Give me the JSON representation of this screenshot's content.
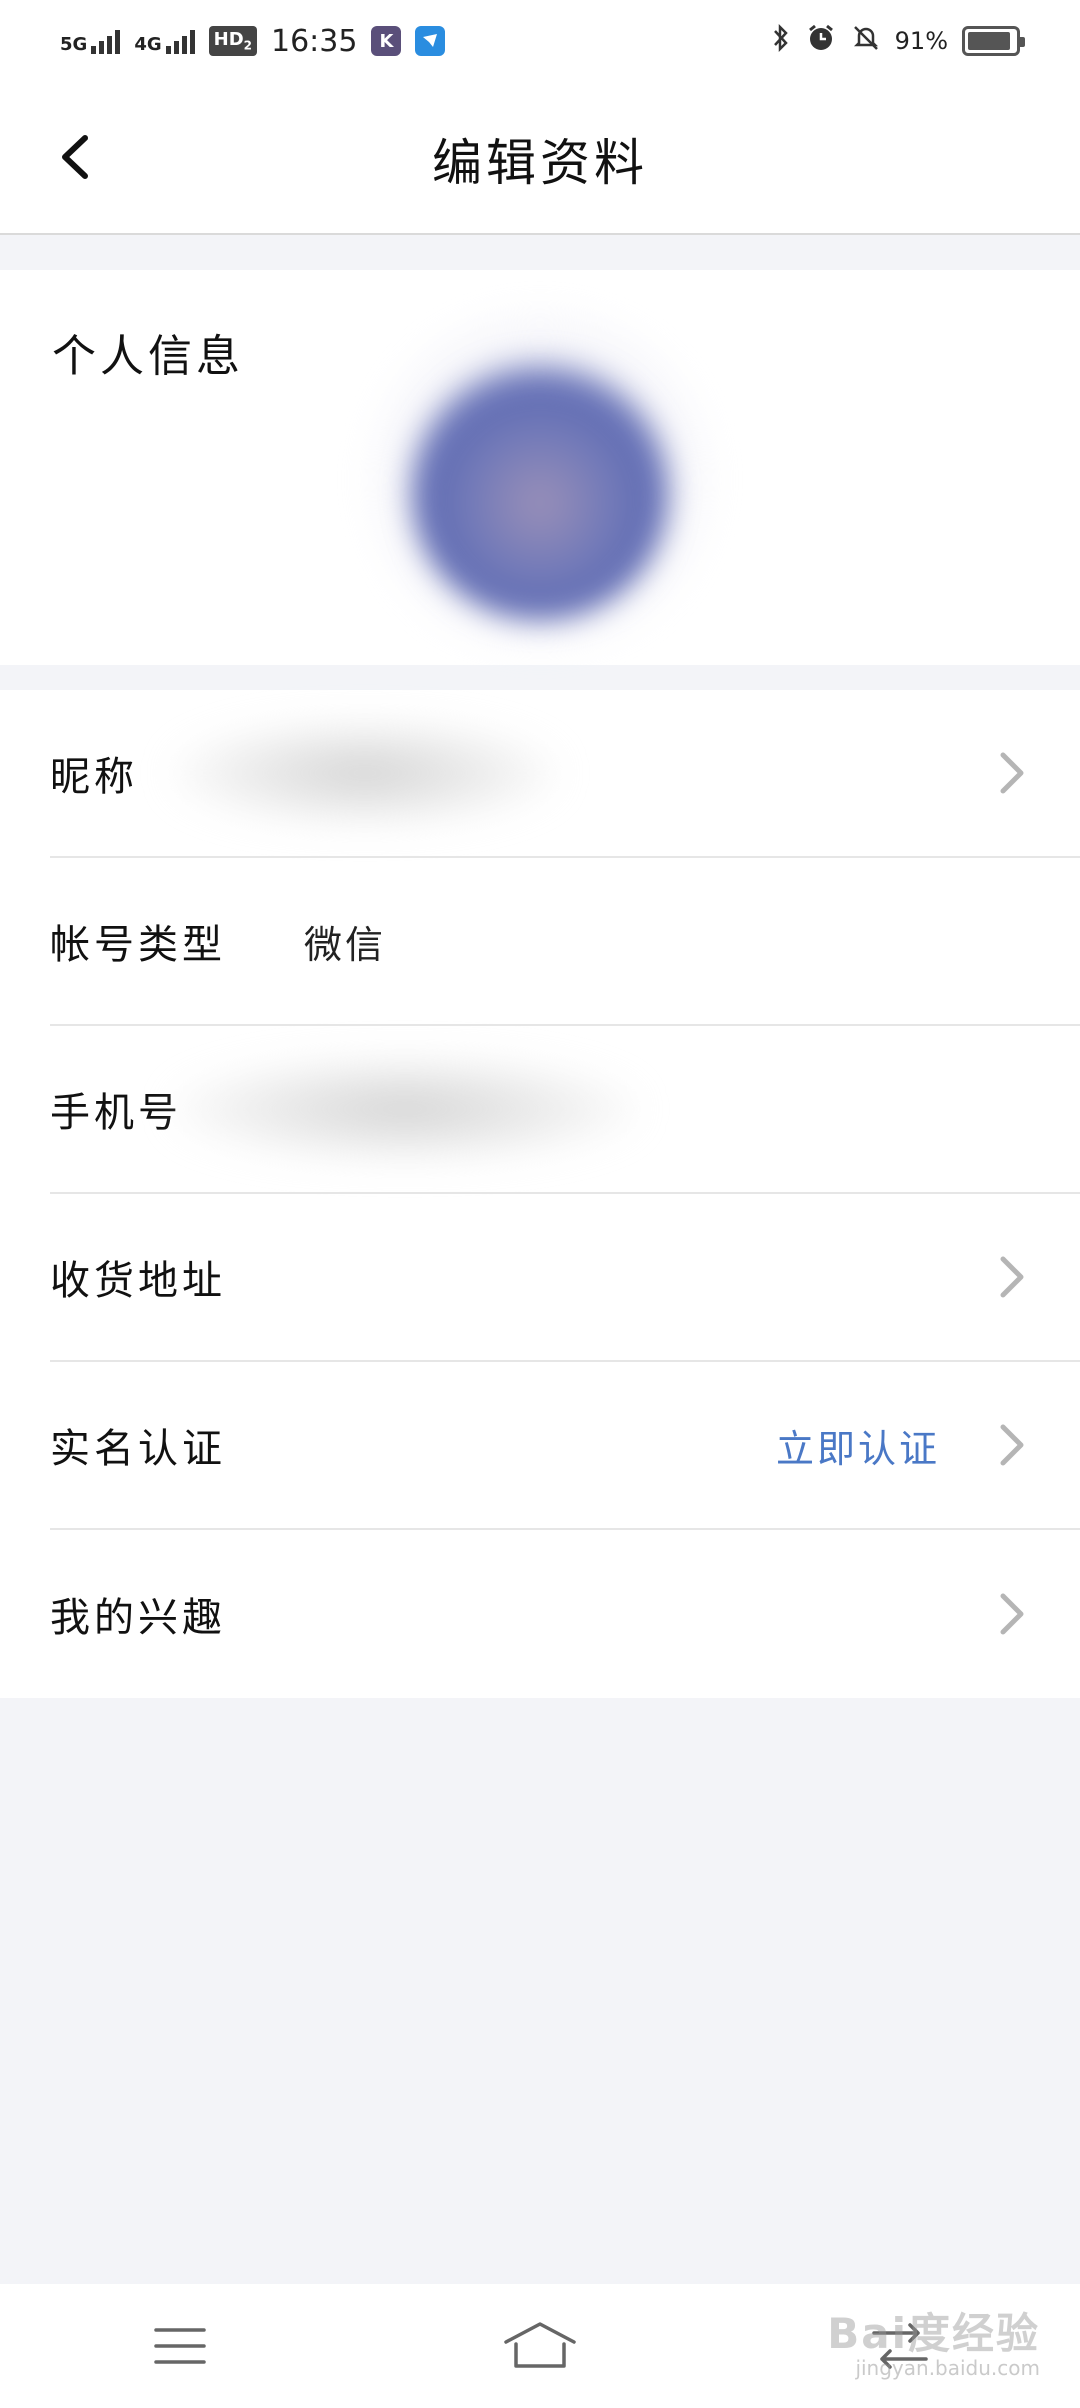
{
  "status_bar": {
    "network1": "5G",
    "network2": "4G",
    "hd": "HD",
    "hd_sub": "2",
    "time": "16:35",
    "app_badge_k": "K",
    "battery_percent": "91%",
    "battery_level": 0.91
  },
  "header": {
    "title": "编辑资料"
  },
  "profile": {
    "section_title": "个人信息"
  },
  "rows": [
    {
      "label": "昵称",
      "value": "",
      "action": "",
      "has_chevron": true
    },
    {
      "label": "帐号类型",
      "value": "微信",
      "action": "",
      "has_chevron": false
    },
    {
      "label": "手机号",
      "value": "",
      "action": "",
      "has_chevron": false
    },
    {
      "label": "收货地址",
      "value": "",
      "action": "",
      "has_chevron": true
    },
    {
      "label": "实名认证",
      "value": "",
      "action": "立即认证",
      "has_chevron": true
    },
    {
      "label": "我的兴趣",
      "value": "",
      "action": "",
      "has_chevron": true
    }
  ],
  "colors": {
    "accent": "#4a78c6",
    "background": "#f3f4f8",
    "card": "#ffffff"
  },
  "watermark": {
    "brand": "Bai度经验",
    "url": "jingyan.baidu.com"
  }
}
